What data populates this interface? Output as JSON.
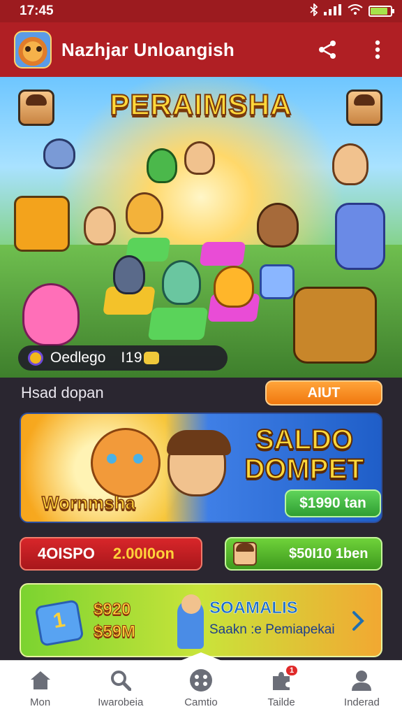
{
  "status_bar": {
    "time": "17:45",
    "battery_level": 0.85,
    "icons": [
      "bluetooth-icon",
      "signal-icon",
      "wifi-icon",
      "battery-icon"
    ]
  },
  "app_bar": {
    "title": "Nazhjar Unloangish",
    "actions": [
      "share-icon",
      "more-vert-icon"
    ]
  },
  "hero": {
    "title": "PERAIMSHA",
    "pill": {
      "label": "Oedlego",
      "value": "I19"
    }
  },
  "section": {
    "label": "Hsad dopan",
    "button": "AIUT"
  },
  "saldo_banner": {
    "title_line1": "SALDO",
    "title_line2": "DOMPET",
    "subtitle": "Wornmsha",
    "button": "$1990 tan"
  },
  "stats": {
    "red_label": "4OISPO",
    "red_value": "2.00I0on",
    "green_value": "$50I10 1ben"
  },
  "promo": {
    "value1": "$920",
    "value2": "$59M",
    "title": "SOAMALIS",
    "subtitle": "Saakn :e Pemiapekai"
  },
  "bottom_nav": {
    "items": [
      {
        "label": "Mon",
        "icon": "home-icon"
      },
      {
        "label": "Iwarobeia",
        "icon": "search-icon"
      },
      {
        "label": "Camtio",
        "icon": "gamepad-icon"
      },
      {
        "label": "Tailde",
        "icon": "puzzle-icon",
        "badge": "1"
      },
      {
        "label": "Inderad",
        "icon": "profile-icon"
      }
    ]
  },
  "colors": {
    "app_bar": "#b01f24",
    "status_bar": "#9c1b1f",
    "accent_orange": "#f0780f",
    "accent_green": "#2f9e32",
    "accent_red": "#d8262a"
  }
}
